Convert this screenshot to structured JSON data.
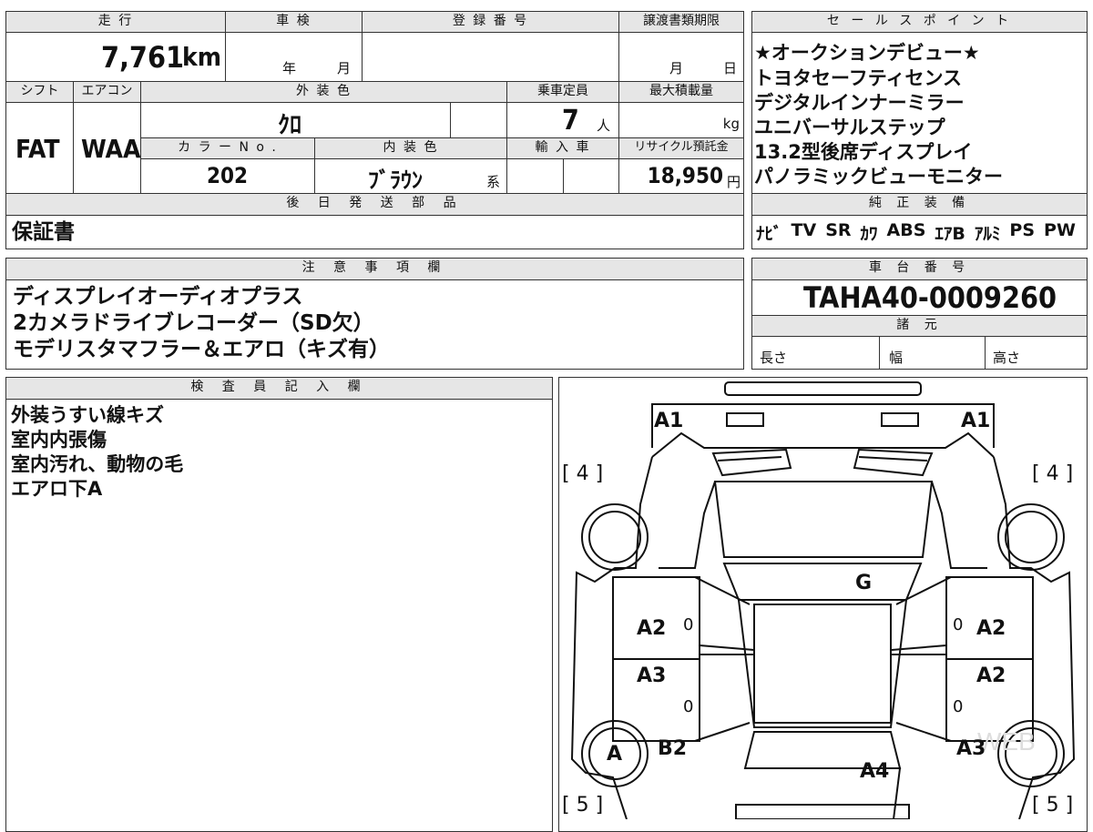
{
  "main": {
    "mileage_label": "走 行",
    "mileage_value": "7,761",
    "mileage_unit": "km",
    "inspection_label": "車 検",
    "inspection_year_unit": "年",
    "inspection_month_unit": "月",
    "registration_label": "登 録 番 号",
    "transfer_label": "譲渡書類期限",
    "transfer_month_unit": "月",
    "transfer_day_unit": "日",
    "shift_label": "シフト",
    "shift_value": "FAT",
    "ac_label": "エアコン",
    "ac_value": "WAA",
    "exterior_label": "外 装 色",
    "exterior_value": "ｸﾛ",
    "capacity_label": "乗車定員",
    "capacity_value": "7",
    "capacity_unit": "人",
    "max_load_label": "最大積載量",
    "max_load_unit": "kg",
    "color_no_label": "カ ラ ー N o .",
    "color_no_value": "202",
    "interior_label": "内 装 色",
    "interior_value": "ﾌﾞﾗｳﾝ",
    "interior_suffix": "系",
    "import_label": "輸 入 車",
    "recycle_label": "リサイクル預託金",
    "recycle_value": "18,950",
    "recycle_unit": "円",
    "later_parts_label": "後 日 発 送 部 品",
    "later_parts_value": "保証書"
  },
  "sales_points": {
    "title": "セ ー ル ス ポ イ ン ト",
    "lines": [
      "★オークションデビュー★",
      "トヨタセーフティセンス",
      "デジタルインナーミラー",
      "ユニバーサルステップ",
      "13.2型後席ディスプレイ",
      "パノラミックビューモニター"
    ]
  },
  "equipment": {
    "title": "純 正 装 備",
    "items": [
      "ﾅﾋﾞ",
      "TV",
      "SR",
      "ｶﾜ",
      "ABS",
      "ｴｱB",
      "ｱﾙﾐ",
      "PS",
      "PW"
    ]
  },
  "notes": {
    "title": "注 意 事 項 欄",
    "lines": [
      "ディスプレイオーディオプラス",
      "2カメラドライブレコーダー（SD欠）",
      "モデリスタマフラー＆エアロ（キズ有）"
    ]
  },
  "chassis": {
    "title": "車 台 番 号",
    "value": "TAHA40-0009260",
    "spec_title": "諸 元",
    "length_label": "長さ",
    "width_label": "幅",
    "height_label": "高さ"
  },
  "inspector": {
    "title": "検 査 員 記 入 欄",
    "lines": [
      "外装うすい線キズ",
      "室内内張傷",
      "室内汚れ、動物の毛",
      "エアロ下A"
    ]
  },
  "diagram": {
    "labels": {
      "a1_left": "A1",
      "a1_right": "A1",
      "four_left": "[ 4 ]",
      "four_right": "[ 4 ]",
      "g": "G",
      "a2_left": "A2",
      "a2_right_front": "A2",
      "a2_right_rear": "A2",
      "a3_left": "A3",
      "a3_right": "A3",
      "zero_1": "0",
      "zero_2": "0",
      "zero_3": "0",
      "zero_4": "0",
      "a_wheel": "A",
      "b2": "B2",
      "a4": "A4",
      "five_left": "[ 5 ]",
      "five_right": "[ 5 ]"
    }
  }
}
